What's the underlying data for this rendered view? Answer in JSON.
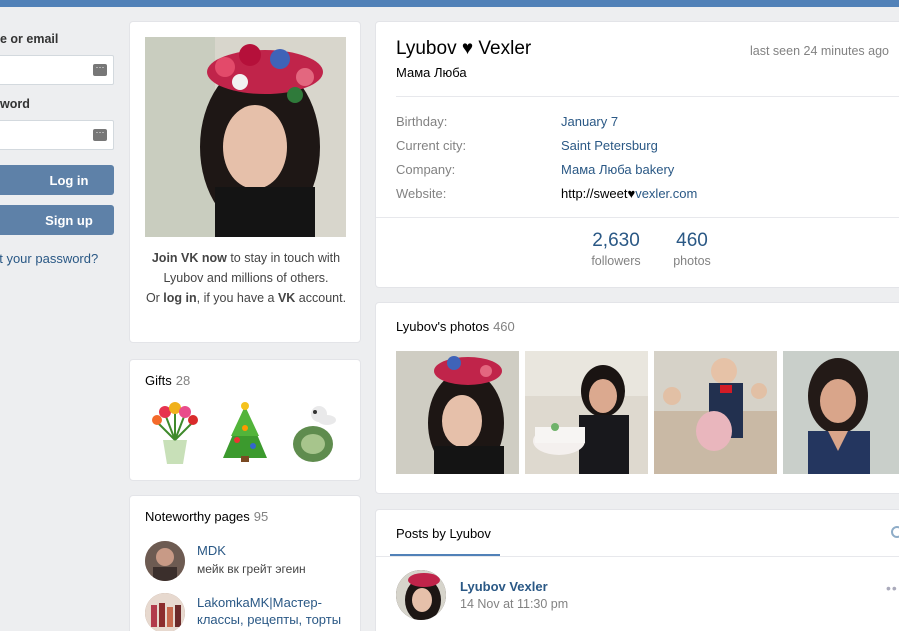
{
  "login": {
    "email_label": "e or email",
    "password_label": "word",
    "login_button": "Log in",
    "signup_button": "Sign up",
    "forgot_link": "ot your password?"
  },
  "profile": {
    "name": "Lyubov ♥ Vexler",
    "status": "Мама Люба",
    "last_seen": "last seen 24 minutes ago",
    "info": [
      {
        "key": "Birthday:",
        "value": "January 7",
        "link": true
      },
      {
        "key": "Current city:",
        "value": "Saint Petersburg",
        "link": true
      },
      {
        "key": "Company:",
        "value": "Мама Люба bakery",
        "link": true
      },
      {
        "key": "Website:",
        "value_plain": "http://sweet♥",
        "value_link": "vexler.com"
      }
    ],
    "counters": [
      {
        "number": "2,630",
        "label": "followers"
      },
      {
        "number": "460",
        "label": "photos"
      }
    ]
  },
  "join": {
    "bold1": "Join VK now",
    "text1": " to stay in touch with Lyubov and millions of others.",
    "or": "Or ",
    "bold2": "log in",
    "text2": ", if you have a ",
    "bold3": "VK",
    "text3": " account."
  },
  "gifts": {
    "title": "Gifts",
    "count": "28"
  },
  "noteworthy": {
    "title": "Noteworthy pages",
    "count": "95",
    "items": [
      {
        "name": "MDK",
        "desc": "мейк вк грейт эгеин"
      },
      {
        "name": "LakomkaMK|Мастер-",
        "desc": "классы, рецепты, торты"
      }
    ]
  },
  "photos": {
    "title": "Lyubov's photos",
    "count": "460"
  },
  "posts": {
    "tab": "Posts by Lyubov",
    "post_author": "Lyubov Vexler",
    "post_date": "14 Nov at 11:30 pm"
  },
  "colors": {
    "accent": "#5181b8",
    "link": "#2a5885",
    "button": "#5e81a8",
    "background": "#edeef0"
  }
}
